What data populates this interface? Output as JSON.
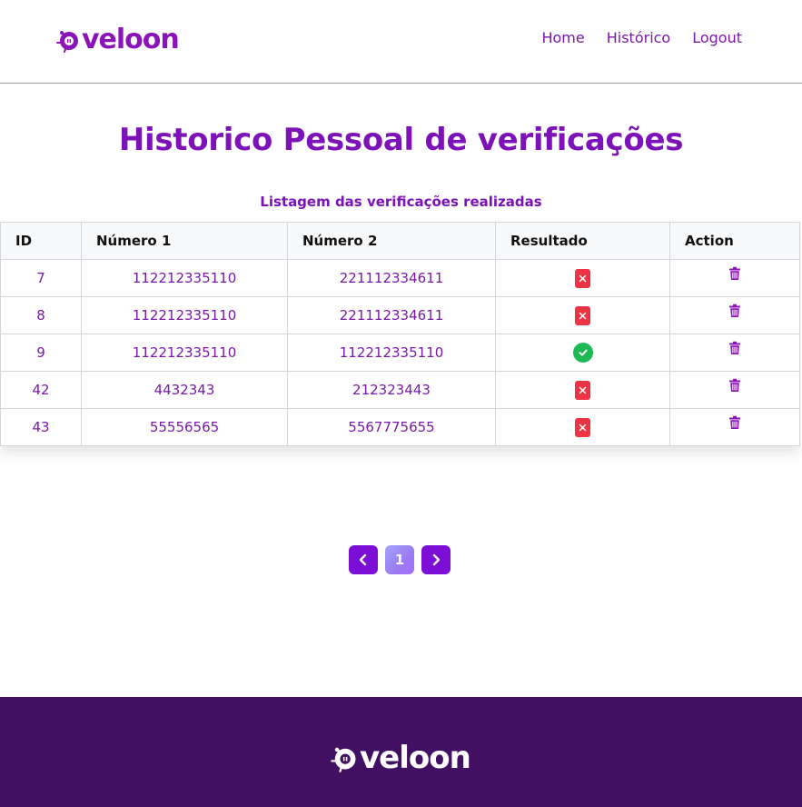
{
  "brand": {
    "name": "veloon",
    "primary_color": "#7d12b8",
    "footer_bg": "#421062",
    "logo_icon": "veloon-logo-icon"
  },
  "nav": {
    "items": [
      {
        "label": "Home"
      },
      {
        "label": "Histórico"
      },
      {
        "label": "Logout"
      }
    ]
  },
  "page": {
    "title": "Historico Pessoal de verificações",
    "subtitle": "Listagem das verificações realizadas"
  },
  "table": {
    "headers": [
      "ID",
      "Número 1",
      "Número 2",
      "Resultado",
      "Action"
    ],
    "rows": [
      {
        "id": "7",
        "num1": "112212335110",
        "num2": "221112334611",
        "result": "fail"
      },
      {
        "id": "8",
        "num1": "112212335110",
        "num2": "221112334611",
        "result": "fail"
      },
      {
        "id": "9",
        "num1": "112212335110",
        "num2": "112212335110",
        "result": "success"
      },
      {
        "id": "42",
        "num1": "4432343",
        "num2": "212323443",
        "result": "fail"
      },
      {
        "id": "43",
        "num1": "55556565",
        "num2": "5567775655",
        "result": "fail"
      }
    ],
    "result_icons": {
      "fail": "x-badge-icon",
      "success": "check-circle-icon"
    },
    "action_icon": "trash-icon",
    "fail_color": "#ee3344",
    "success_color": "#1db954"
  },
  "pagination": {
    "current_page": "1",
    "prev_icon": "chevron-left-icon",
    "next_icon": "chevron-right-icon"
  }
}
